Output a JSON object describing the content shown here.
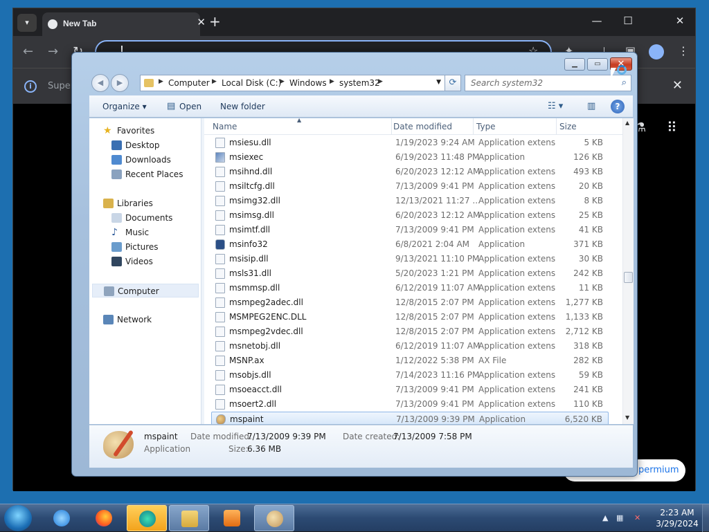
{
  "chrome": {
    "tab_title": "New Tab",
    "tab_close": "✕",
    "new_tab": "+",
    "infobar_text": "Super",
    "infobar_close": "✕",
    "promo_button": "permium"
  },
  "explorer": {
    "breadcrumb": [
      "Computer",
      "Local Disk (C:)",
      "Windows",
      "system32"
    ],
    "search_placeholder": "Search system32",
    "toolbar": {
      "organize": "Organize",
      "open": "Open",
      "new_folder": "New folder"
    },
    "nav": {
      "favorites": "Favorites",
      "desktop": "Desktop",
      "downloads": "Downloads",
      "recent_places": "Recent Places",
      "libraries": "Libraries",
      "documents": "Documents",
      "music": "Music",
      "pictures": "Pictures",
      "videos": "Videos",
      "computer": "Computer",
      "network": "Network"
    },
    "columns": {
      "name": "Name",
      "date": "Date modified",
      "type": "Type",
      "size": "Size"
    },
    "files": [
      {
        "name": "msiesu.dll",
        "date": "1/19/2023 9:24 AM",
        "type": "Application extens...",
        "size": "5 KB",
        "icon": "dll"
      },
      {
        "name": "msiexec",
        "date": "6/19/2023 11:48 PM",
        "type": "Application",
        "size": "126 KB",
        "icon": "app"
      },
      {
        "name": "msihnd.dll",
        "date": "6/20/2023 12:12 AM",
        "type": "Application extens...",
        "size": "493 KB",
        "icon": "dll"
      },
      {
        "name": "msiltcfg.dll",
        "date": "7/13/2009 9:41 PM",
        "type": "Application extens...",
        "size": "20 KB",
        "icon": "dll"
      },
      {
        "name": "msimg32.dll",
        "date": "12/13/2021 11:27 ...",
        "type": "Application extens...",
        "size": "8 KB",
        "icon": "dll"
      },
      {
        "name": "msimsg.dll",
        "date": "6/20/2023 12:12 AM",
        "type": "Application extens...",
        "size": "25 KB",
        "icon": "dll"
      },
      {
        "name": "msimtf.dll",
        "date": "7/13/2009 9:41 PM",
        "type": "Application extens...",
        "size": "41 KB",
        "icon": "dll"
      },
      {
        "name": "msinfo32",
        "date": "6/8/2021 2:04 AM",
        "type": "Application",
        "size": "371 KB",
        "icon": "info"
      },
      {
        "name": "msisip.dll",
        "date": "9/13/2021 11:10 PM",
        "type": "Application extens...",
        "size": "30 KB",
        "icon": "dll"
      },
      {
        "name": "msls31.dll",
        "date": "5/20/2023 1:21 PM",
        "type": "Application extens...",
        "size": "242 KB",
        "icon": "dll"
      },
      {
        "name": "msmmsp.dll",
        "date": "6/12/2019 11:07 AM",
        "type": "Application extens...",
        "size": "11 KB",
        "icon": "dll"
      },
      {
        "name": "msmpeg2adec.dll",
        "date": "12/8/2015 2:07 PM",
        "type": "Application extens...",
        "size": "1,277 KB",
        "icon": "dll"
      },
      {
        "name": "MSMPEG2ENC.DLL",
        "date": "12/8/2015 2:07 PM",
        "type": "Application extens...",
        "size": "1,133 KB",
        "icon": "dll"
      },
      {
        "name": "msmpeg2vdec.dll",
        "date": "12/8/2015 2:07 PM",
        "type": "Application extens...",
        "size": "2,712 KB",
        "icon": "dll"
      },
      {
        "name": "msnetobj.dll",
        "date": "6/12/2019 11:07 AM",
        "type": "Application extens...",
        "size": "318 KB",
        "icon": "dll"
      },
      {
        "name": "MSNP.ax",
        "date": "1/12/2022 5:38 PM",
        "type": "AX File",
        "size": "282 KB",
        "icon": "file"
      },
      {
        "name": "msobjs.dll",
        "date": "7/14/2023 11:16 PM",
        "type": "Application extens...",
        "size": "59 KB",
        "icon": "dll"
      },
      {
        "name": "msoeacct.dll",
        "date": "7/13/2009 9:41 PM",
        "type": "Application extens...",
        "size": "241 KB",
        "icon": "dll"
      },
      {
        "name": "msoert2.dll",
        "date": "7/13/2009 9:41 PM",
        "type": "Application extens...",
        "size": "110 KB",
        "icon": "dll"
      },
      {
        "name": "mspaint",
        "date": "7/13/2009 9:39 PM",
        "type": "Application",
        "size": "6,520 KB",
        "icon": "paint",
        "selected": true
      }
    ],
    "details": {
      "name": "mspaint",
      "kind": "Application",
      "modified_label": "Date modified:",
      "modified": "7/13/2009 9:39 PM",
      "size_label": "Size:",
      "size": "6.36 MB",
      "created_label": "Date created:",
      "created": "7/13/2009 7:58 PM"
    }
  },
  "taskbar": {
    "time": "2:23 AM",
    "date": "3/29/2024"
  }
}
